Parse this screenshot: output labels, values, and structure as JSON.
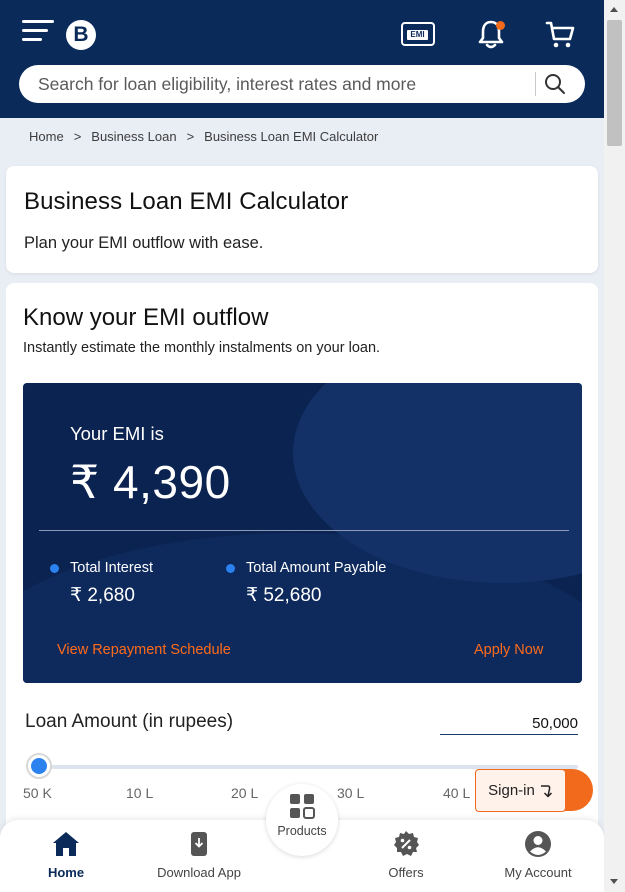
{
  "header": {
    "logo_letter": "B",
    "emi_icon_text": "EMI",
    "search_placeholder": "Search for loan eligibility, interest rates and more"
  },
  "breadcrumb": [
    "Home",
    "Business Loan",
    "Business Loan EMI Calculator"
  ],
  "intro_card": {
    "title": "Business Loan EMI Calculator",
    "subtitle": "Plan your EMI outflow with ease."
  },
  "calculator": {
    "title": "Know your EMI outflow",
    "subtitle": "Instantly estimate the monthly instalments on your loan.",
    "emi_label": "Your EMI is",
    "emi_value": "₹ 4,390",
    "total_interest_label": "Total Interest",
    "total_interest_value": "₹ 2,680",
    "total_payable_label": "Total Amount Payable",
    "total_payable_value": "₹ 52,680",
    "repayment_link": "View Repayment Schedule",
    "apply_link": "Apply Now",
    "loan_amount_label": "Loan Amount (in rupees)",
    "loan_amount_value": "50,000",
    "slider_ticks": [
      "50 K",
      "10 L",
      "20 L",
      "30 L",
      "40 L"
    ],
    "slider_level_fraction": 0.0
  },
  "signin_label": "Sign-in",
  "bottom_nav": {
    "home": "Home",
    "download": "Download App",
    "products": "Products",
    "offers": "Offers",
    "account": "My Account"
  },
  "colors": {
    "header_bg": "#0a2a5a",
    "accent_orange": "#f26a1b",
    "link_orange": "#ff6b1a",
    "dot_blue": "#2b82ef",
    "panel_bg": "#0b2350"
  }
}
